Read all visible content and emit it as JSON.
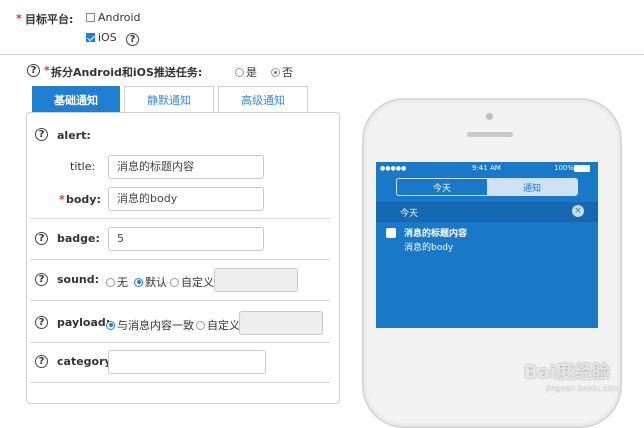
{
  "platform": {
    "label": "目标平台:",
    "required_mark": "*",
    "options": [
      {
        "label": "Android",
        "checked": false
      },
      {
        "label": "iOS",
        "checked": true
      }
    ],
    "help": "?"
  },
  "split_task": {
    "required_mark": "*",
    "label": "拆分Android和iOS推送任务:",
    "help": "?",
    "options": [
      {
        "label": "是",
        "selected": false
      },
      {
        "label": "否",
        "selected": true
      }
    ]
  },
  "tabs": [
    {
      "label": "基础通知",
      "active": true
    },
    {
      "label": "静默通知",
      "active": false
    },
    {
      "label": "高级通知",
      "active": false
    }
  ],
  "form": {
    "alert_label": "alert:",
    "title_label": "title:",
    "title_value": "消息的标题内容",
    "body_required_mark": "*",
    "body_label": "body:",
    "body_value": "消息的body",
    "badge_label": "badge:",
    "badge_value": "5",
    "sound_label": "sound:",
    "sound_options": [
      "无",
      "默认",
      "自定义"
    ],
    "sound_selected": "默认",
    "payload_label": "payload:",
    "payload_options": [
      "与消息内容一致",
      "自定义"
    ],
    "payload_selected": "与消息内容一致",
    "category_label": "category:",
    "help": "?"
  },
  "phone": {
    "status_time": "9:41 AM",
    "status_battery": "100%",
    "segments": [
      "今天",
      "通知"
    ],
    "section": "今天",
    "notification_title": "消息的标题内容",
    "notification_body": "消息的body"
  },
  "watermark": {
    "brand": "Bai度经验",
    "url": "jingyan.baidu.com"
  },
  "colors": {
    "accent": "#1f7fd2",
    "required": "#e0302d",
    "phone_screen": "#1a78c8"
  }
}
